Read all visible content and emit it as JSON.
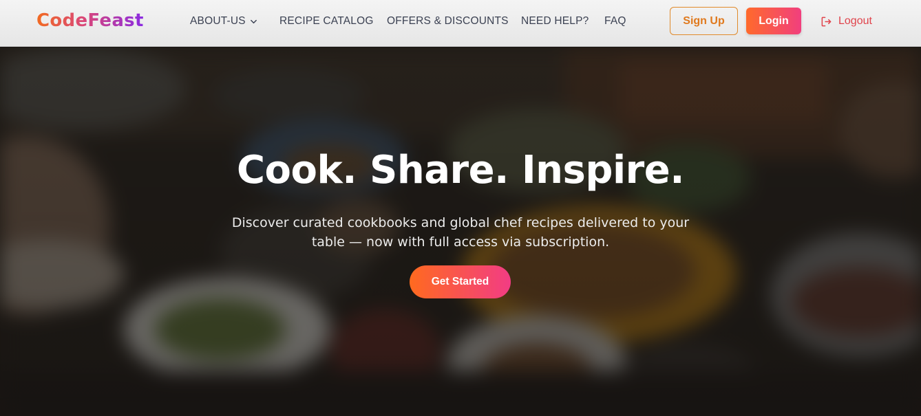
{
  "header": {
    "logo": "CodeFeast",
    "nav": [
      {
        "label": "ABOUT-US",
        "has_dropdown": true
      },
      {
        "label": "RECIPE CATALOG"
      },
      {
        "label": "OFFERS & DISCOUNTS"
      },
      {
        "label": "NEED HELP?"
      },
      {
        "label": "FAQ"
      }
    ],
    "signup_label": "Sign Up",
    "login_label": "Login",
    "logout_label": "Logout",
    "logout_icon": "logout-icon",
    "dropdown_icon": "chevron-down-icon"
  },
  "hero": {
    "title": "Cook. Share. Inspire.",
    "subtitle": "Discover curated cookbooks and global chef recipes delivered to your table — now with full access via subscription.",
    "cta_label": "Get Started",
    "background": "blurred-food-table-photo"
  },
  "colors": {
    "accent_orange": "#ff6a2b",
    "accent_pink": "#f13f7e",
    "logo_purple": "#8a2be2",
    "signup_border": "#e08a2a",
    "logout_red": "#e0434b",
    "nav_text": "#3b4152"
  }
}
